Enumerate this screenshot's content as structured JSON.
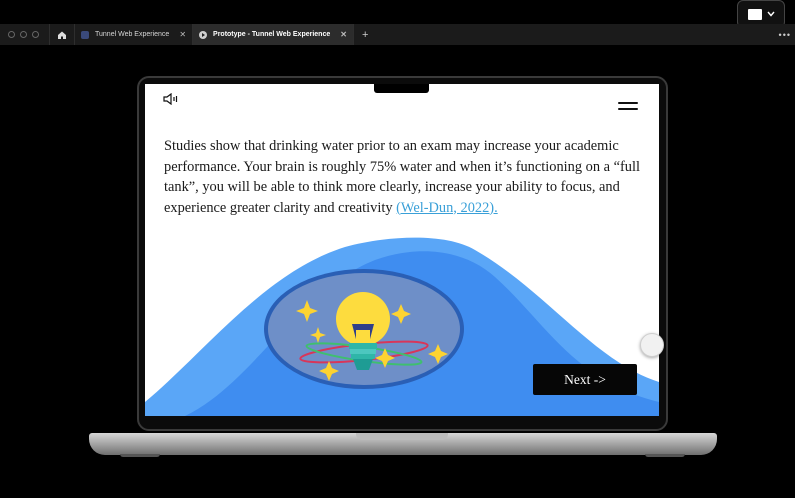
{
  "browser": {
    "tabs": [
      {
        "label": "Tunnel Web Experience",
        "active": false
      },
      {
        "label": "Prototype - Tunnel Web Experience",
        "active": true
      }
    ]
  },
  "slide": {
    "body_before_link": "Studies show that drinking water prior to an exam may increase your academic performance. Your brain is roughly 75% water and when it’s functioning on a “full tank”, you will be able to think more clearly, increase your ability to focus, and experience greater clarity and creativity ",
    "citation_link": "(Wel-Dun, 2022).",
    "next_label": "Next ->"
  },
  "colors": {
    "accent_blue": "#4a9af5",
    "link_blue": "#3aa0d8",
    "bulb_yellow": "#fddc3e"
  }
}
